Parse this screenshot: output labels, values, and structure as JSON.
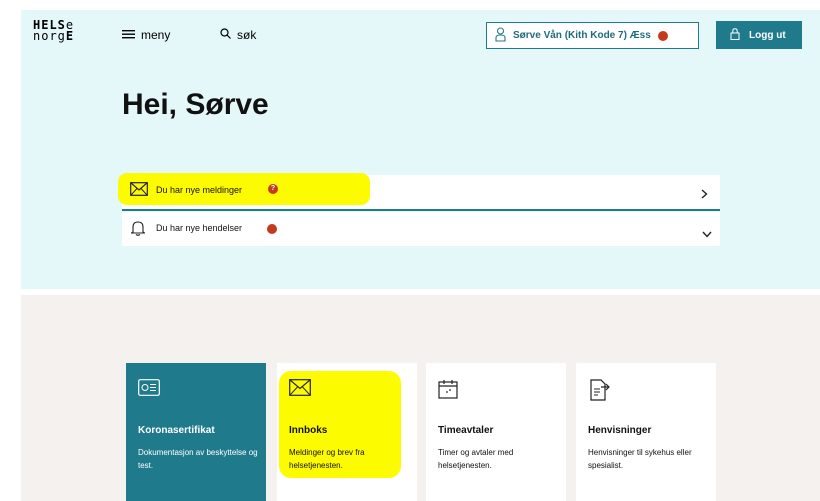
{
  "header": {
    "logo_line1": "HELSe",
    "logo_line2": "norgE",
    "menu_label": "meny",
    "search_label": "søk",
    "user_label": "Sørve Vån (Kith Kode 7) Æss",
    "logout_label": "Logg ut"
  },
  "main": {
    "greeting": "Hei, Sørve",
    "notifications": [
      {
        "label": "Du har nye meldinger",
        "badge": "?",
        "icon": "envelope-icon",
        "action": "chevron-right-icon"
      },
      {
        "label": "Du har nye hendelser",
        "badge": "•",
        "icon": "bell-icon",
        "action": "chevron-down-icon"
      }
    ]
  },
  "tiles": [
    {
      "title": "Koronasertifikat",
      "description": "Dokumentasjon av beskyttelse og test.",
      "icon": "certificate-icon"
    },
    {
      "title": "Innboks",
      "description": "Meldinger og brev fra helsetjenesten.",
      "icon": "envelope-icon"
    },
    {
      "title": "Timeavtaler",
      "description": "Timer og avtaler med helsetjenesten.",
      "icon": "calendar-icon"
    },
    {
      "title": "Henvisninger",
      "description": "Henvisninger til sykehus eller spesialist.",
      "icon": "referral-document-icon"
    }
  ],
  "colors": {
    "hero_bg": "#e4f7f9",
    "lower_bg": "#f5f1ef",
    "brand_teal": "#1f7a8c",
    "badge_red": "#c5391f",
    "highlight_yellow": "#fdfb00"
  }
}
